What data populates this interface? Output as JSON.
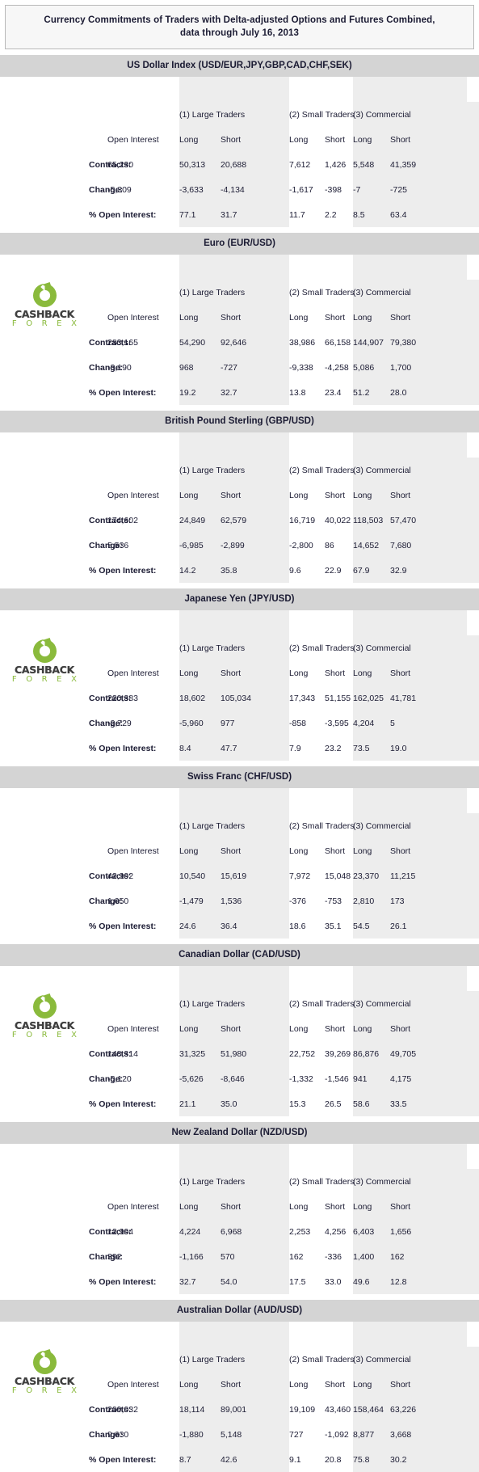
{
  "report": {
    "title_line1": "Currency Commitments of Traders with Delta-adjusted Options and Futures Combined,",
    "title_line2": "data through July 16, 2013"
  },
  "logo": {
    "word_top": "CASHBACK",
    "word_bottom": "F O R E X",
    "icon": "circular-arrow-refresh-icon",
    "green": "#8aba3c",
    "dark": "#3f3f3f"
  },
  "colors": {
    "section_header_bg": "#d4d4d4",
    "group_shade_bg": "#ededed",
    "title_bg": "#f7f7f7",
    "title_border": "#b9b9b9",
    "text": "#1b1b33"
  },
  "columns": {
    "open_interest": "Open Interest",
    "groups": [
      {
        "label": "(1) Large Traders",
        "long": "Long",
        "short": "Short",
        "shaded": true
      },
      {
        "label": "(2) Small Traders",
        "long": "Long",
        "short": "Short",
        "shaded": false
      },
      {
        "label": "(3) Commercial",
        "long": "Long",
        "short": "Short",
        "shaded": true
      }
    ],
    "rows": [
      "Contracts:",
      "Change:",
      "% Open Interest:"
    ]
  },
  "sections": [
    {
      "title": "US Dollar Index (USD/EUR,JPY,GBP,CAD,CHF,SEK)",
      "has_logo": false,
      "contracts": {
        "oi": "65,230",
        "g1_long": "50,313",
        "g1_short": "20,688",
        "g2_long": "7,612",
        "g2_short": "1,426",
        "g3_long": "5,548",
        "g3_short": "41,359"
      },
      "change": {
        "oi": "-5,309",
        "g1_long": "-3,633",
        "g1_short": "-4,134",
        "g2_long": "-1,617",
        "g2_short": "-398",
        "g3_long": "-7",
        "g3_short": "-725"
      },
      "pct_open_int": {
        "oi": "",
        "g1_long": "77.1",
        "g1_short": "31.7",
        "g2_long": "11.7",
        "g2_short": "2.2",
        "g3_long": "8.5",
        "g3_short": "63.4"
      }
    },
    {
      "title": "Euro (EUR/USD)",
      "has_logo": true,
      "contracts": {
        "oi": "283,165",
        "g1_long": "54,290",
        "g1_short": "92,646",
        "g2_long": "38,986",
        "g2_short": "66,158",
        "g3_long": "144,907",
        "g3_short": "79,380"
      },
      "change": {
        "oi": "-3,190",
        "g1_long": "968",
        "g1_short": "-727",
        "g2_long": "-9,338",
        "g2_short": "-4,258",
        "g3_long": "5,086",
        "g3_short": "1,700"
      },
      "pct_open_int": {
        "oi": "",
        "g1_long": "19.2",
        "g1_short": "32.7",
        "g2_long": "13.8",
        "g2_short": "23.4",
        "g3_long": "51.2",
        "g3_short": "28.0"
      }
    },
    {
      "title": "British Pound Sterling (GBP/USD)",
      "has_logo": false,
      "contracts": {
        "oi": "174,602",
        "g1_long": "24,849",
        "g1_short": "62,579",
        "g2_long": "16,719",
        "g2_short": "40,022",
        "g3_long": "118,503",
        "g3_short": "57,470"
      },
      "change": {
        "oi": "5,536",
        "g1_long": "-6,985",
        "g1_short": "-2,899",
        "g2_long": "-2,800",
        "g2_short": "86",
        "g3_long": "14,652",
        "g3_short": "7,680"
      },
      "pct_open_int": {
        "oi": "",
        "g1_long": "14.2",
        "g1_short": "35.8",
        "g2_long": "9.6",
        "g2_short": "22.9",
        "g3_long": "67.9",
        "g3_short": "32.9"
      }
    },
    {
      "title": "Japanese Yen (JPY/USD)",
      "has_logo": true,
      "contracts": {
        "oi": "220,383",
        "g1_long": "18,602",
        "g1_short": "105,034",
        "g2_long": "17,343",
        "g2_short": "51,155",
        "g3_long": "162,025",
        "g3_short": "41,781"
      },
      "change": {
        "oi": "-2,729",
        "g1_long": "-5,960",
        "g1_short": "977",
        "g2_long": "-858",
        "g2_short": "-3,595",
        "g3_long": "4,204",
        "g3_short": "5"
      },
      "pct_open_int": {
        "oi": "",
        "g1_long": "8.4",
        "g1_short": "47.7",
        "g2_long": "7.9",
        "g2_short": "23.2",
        "g3_long": "73.5",
        "g3_short": "19.0"
      }
    },
    {
      "title": "Swiss Franc (CHF/USD)",
      "has_logo": false,
      "contracts": {
        "oi": "42,902",
        "g1_long": "10,540",
        "g1_short": "15,619",
        "g2_long": "7,972",
        "g2_short": "15,048",
        "g3_long": "23,370",
        "g3_short": "11,215"
      },
      "change": {
        "oi": "1,050",
        "g1_long": "-1,479",
        "g1_short": "1,536",
        "g2_long": "-376",
        "g2_short": "-753",
        "g3_long": "2,810",
        "g3_short": "173"
      },
      "pct_open_int": {
        "oi": "",
        "g1_long": "24.6",
        "g1_short": "36.4",
        "g2_long": "18.6",
        "g2_short": "35.1",
        "g3_long": "54.5",
        "g3_short": "26.1"
      }
    },
    {
      "title": "Canadian Dollar (CAD/USD)",
      "has_logo": true,
      "contracts": {
        "oi": "148,314",
        "g1_long": "31,325",
        "g1_short": "51,980",
        "g2_long": "22,752",
        "g2_short": "39,269",
        "g3_long": "86,876",
        "g3_short": "49,705"
      },
      "change": {
        "oi": "-5,120",
        "g1_long": "-5,626",
        "g1_short": "-8,646",
        "g2_long": "-1,332",
        "g2_short": "-1,546",
        "g3_long": "941",
        "g3_short": "4,175"
      },
      "pct_open_int": {
        "oi": "",
        "g1_long": "21.1",
        "g1_short": "35.0",
        "g2_long": "15.3",
        "g2_short": "26.5",
        "g3_long": "58.6",
        "g3_short": "33.5"
      }
    },
    {
      "title": "New Zealand Dollar (NZD/USD)",
      "has_logo": false,
      "contracts": {
        "oi": "12,904",
        "g1_long": "4,224",
        "g1_short": "6,968",
        "g2_long": "2,253",
        "g2_short": "4,256",
        "g3_long": "6,403",
        "g3_short": "1,656"
      },
      "change": {
        "oi": "392",
        "g1_long": "-1,166",
        "g1_short": "570",
        "g2_long": "162",
        "g2_short": "-336",
        "g3_long": "1,400",
        "g3_short": "162"
      },
      "pct_open_int": {
        "oi": "",
        "g1_long": "32.7",
        "g1_short": "54.0",
        "g2_long": "17.5",
        "g2_short": "33.0",
        "g3_long": "49.6",
        "g3_short": "12.8"
      }
    },
    {
      "title": "Australian Dollar (AUD/USD)",
      "has_logo": true,
      "contracts": {
        "oi": "209,032",
        "g1_long": "18,114",
        "g1_short": "89,001",
        "g2_long": "19,109",
        "g2_short": "43,460",
        "g3_long": "158,464",
        "g3_short": "63,226"
      },
      "change": {
        "oi": "9,630",
        "g1_long": "-1,880",
        "g1_short": "5,148",
        "g2_long": "727",
        "g2_short": "-1,092",
        "g3_long": "8,877",
        "g3_short": "3,668"
      },
      "pct_open_int": {
        "oi": "",
        "g1_long": "8.7",
        "g1_short": "42.6",
        "g2_long": "9.1",
        "g2_short": "20.8",
        "g3_long": "75.8",
        "g3_short": "30.2"
      }
    }
  ]
}
